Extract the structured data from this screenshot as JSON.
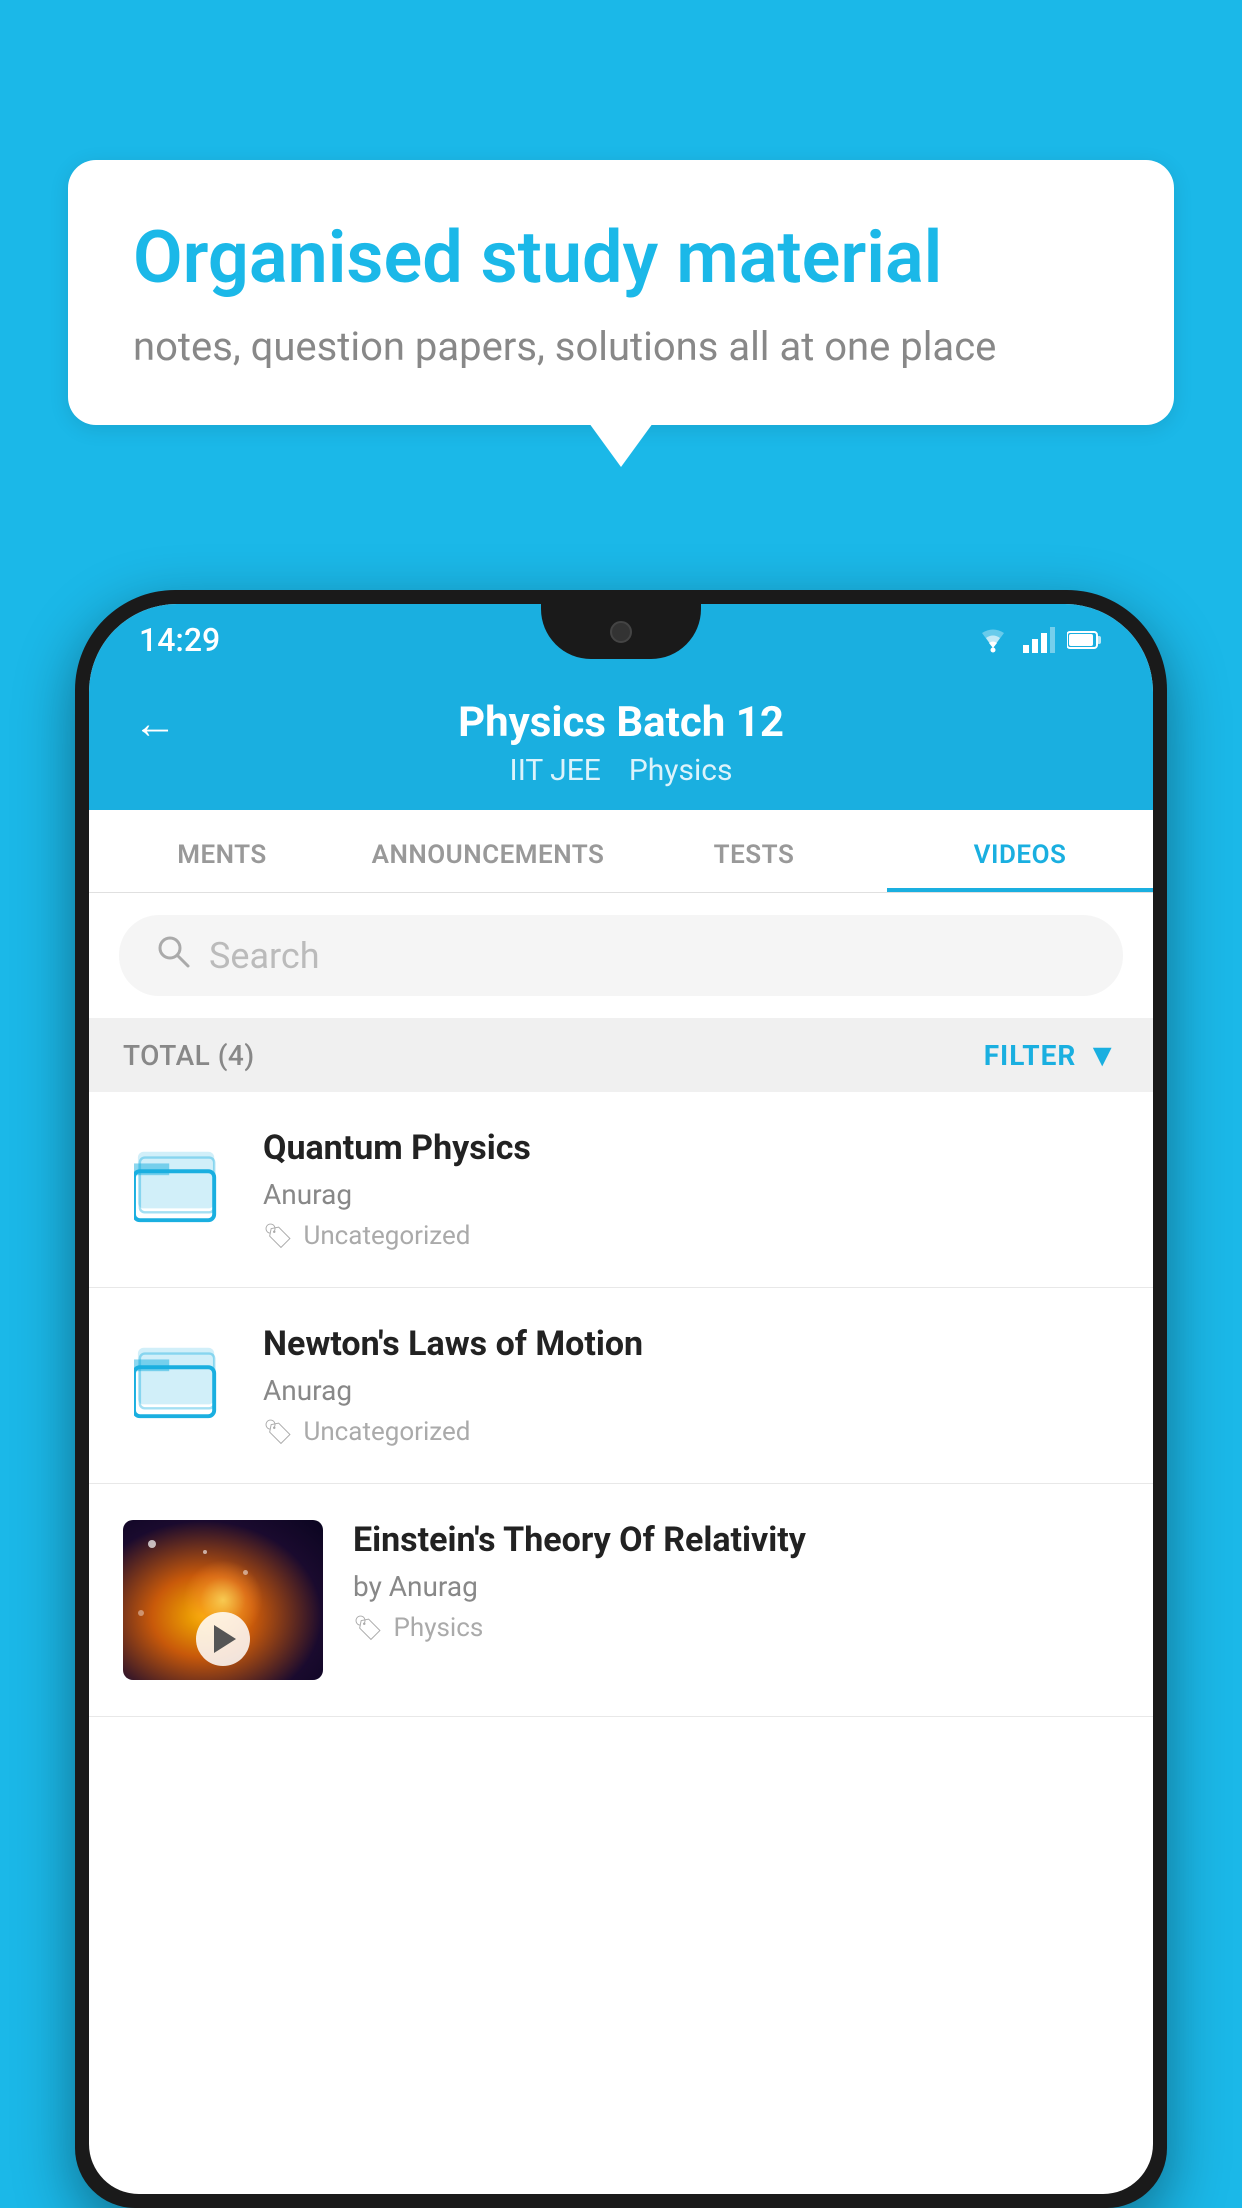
{
  "background_color": "#1bb8e8",
  "speech_bubble": {
    "title": "Organised study material",
    "subtitle": "notes, question papers, solutions all at one place"
  },
  "phone": {
    "status_bar": {
      "time": "14:29",
      "icons": [
        "wifi",
        "signal",
        "battery"
      ]
    },
    "header": {
      "back_label": "←",
      "title": "Physics Batch 12",
      "tags": [
        "IIT JEE",
        "Physics"
      ]
    },
    "tabs": [
      {
        "label": "MENTS",
        "active": false
      },
      {
        "label": "ANNOUNCEMENTS",
        "active": false
      },
      {
        "label": "TESTS",
        "active": false
      },
      {
        "label": "VIDEOS",
        "active": true
      }
    ],
    "search": {
      "placeholder": "Search"
    },
    "filter_bar": {
      "total_label": "TOTAL (4)",
      "filter_label": "FILTER"
    },
    "videos": [
      {
        "id": 1,
        "title": "Quantum Physics",
        "author": "Anurag",
        "tag": "Uncategorized",
        "type": "folder",
        "has_thumbnail": false
      },
      {
        "id": 2,
        "title": "Newton's Laws of Motion",
        "author": "Anurag",
        "tag": "Uncategorized",
        "type": "folder",
        "has_thumbnail": false
      },
      {
        "id": 3,
        "title": "Einstein's Theory Of Relativity",
        "author": "by Anurag",
        "tag": "Physics",
        "type": "video",
        "has_thumbnail": true
      }
    ]
  }
}
